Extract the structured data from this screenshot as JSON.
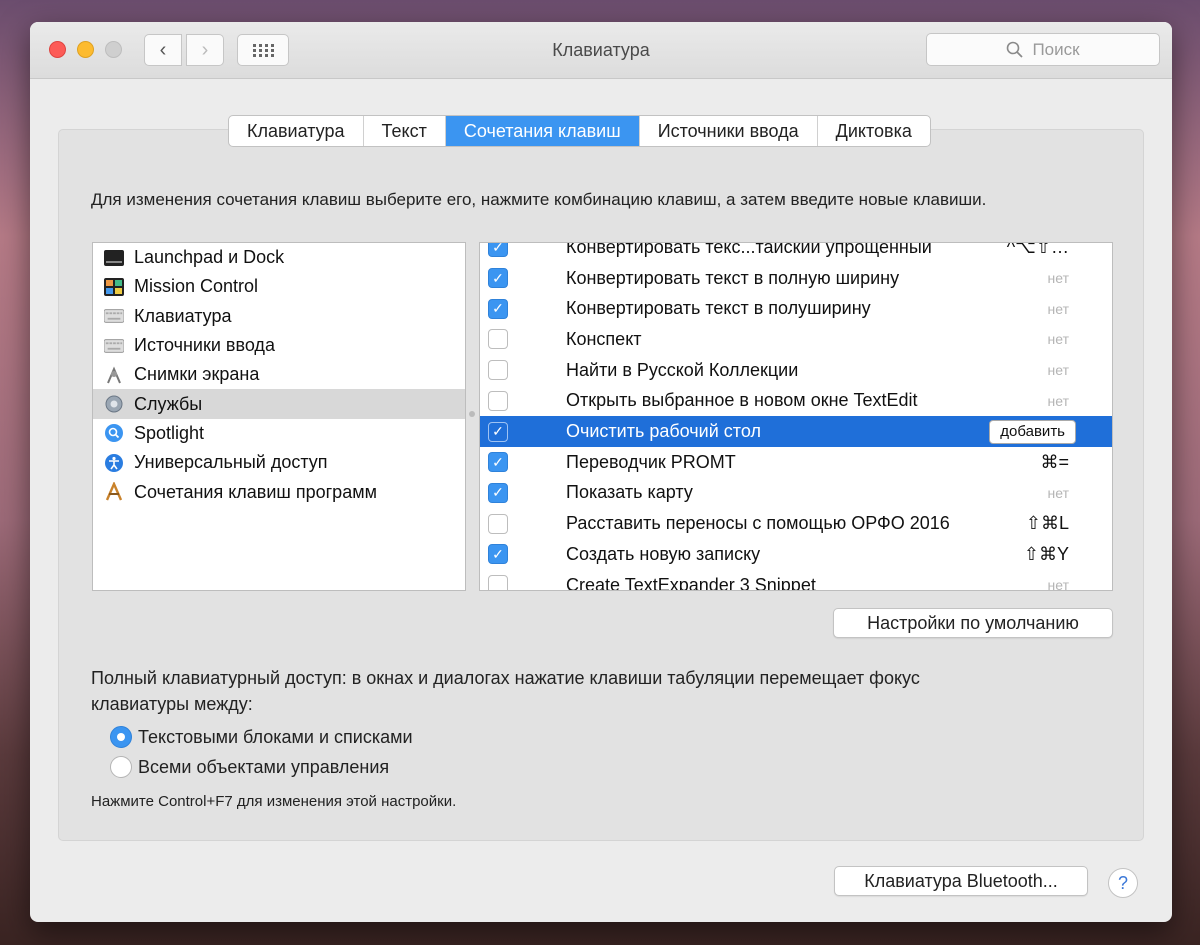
{
  "window": {
    "title": "Клавиатура"
  },
  "search": {
    "placeholder": "Поиск"
  },
  "tabs": [
    "Клавиатура",
    "Текст",
    "Сочетания клавиш",
    "Источники ввода",
    "Диктовка"
  ],
  "instructions": "Для изменения сочетания клавиш выберите его, нажмите комбинацию клавиш, а затем введите новые клавиши.",
  "categories": [
    {
      "label": "Launchpad и Dock",
      "icon": "launchpad-icon"
    },
    {
      "label": "Mission Control",
      "icon": "mission-control-icon"
    },
    {
      "label": "Клавиатура",
      "icon": "keyboard-icon"
    },
    {
      "label": "Источники ввода",
      "icon": "keyboard-icon"
    },
    {
      "label": "Снимки экрана",
      "icon": "screenshot-icon"
    },
    {
      "label": "Службы",
      "icon": "gear-icon",
      "selected": true
    },
    {
      "label": "Spotlight",
      "icon": "spotlight-icon"
    },
    {
      "label": "Универсальный доступ",
      "icon": "accessibility-icon"
    },
    {
      "label": "Сочетания клавиш программ",
      "icon": "app-shortcuts-icon"
    }
  ],
  "shortcuts": [
    {
      "label": "Конвертировать текс...таиский упрощенный",
      "checked": true,
      "key": "^⌥⇧…"
    },
    {
      "label": "Конвертировать текст в полную ширину",
      "checked": true,
      "key": "нет"
    },
    {
      "label": "Конвертировать текст в полуширину",
      "checked": true,
      "key": "нет"
    },
    {
      "label": "Конспект",
      "checked": false,
      "key": "нет"
    },
    {
      "label": "Найти в Русской Коллекции",
      "checked": false,
      "key": "нет"
    },
    {
      "label": "Открыть выбранное в новом окне TextEdit",
      "checked": false,
      "key": "нет"
    },
    {
      "label": "Очистить рабочий стол",
      "checked": true,
      "key": "добавить",
      "selected": true
    },
    {
      "label": "Переводчик PROMT",
      "checked": true,
      "key": "⌘="
    },
    {
      "label": "Показать карту",
      "checked": true,
      "key": "нет"
    },
    {
      "label": "Расставить переносы с помощью ОРФО 2016",
      "checked": false,
      "key": "⇧⌘L"
    },
    {
      "label": "Создать новую записку",
      "checked": true,
      "key": "⇧⌘Y"
    },
    {
      "label": "Create TextExpander 3 Snippet",
      "checked": false,
      "key": "нет"
    }
  ],
  "buttons": {
    "defaults": "Настройки по умолчанию",
    "bluetooth": "Клавиатура Bluetooth...",
    "help": "?"
  },
  "keyboard_access": {
    "text": "Полный клавиатурный доступ: в окнах и диалогах нажатие клавиши табуляции перемещает фокус клавиатуры между:",
    "option1": "Текстовыми блоками и списками",
    "option2": "Всеми объектами управления",
    "note": "Нажмите Control+F7 для изменения этой настройки."
  }
}
